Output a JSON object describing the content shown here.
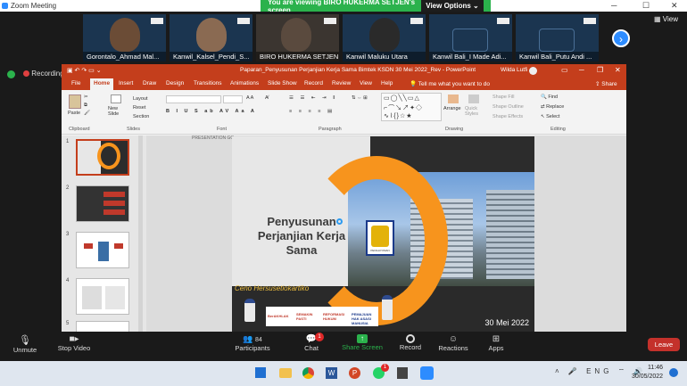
{
  "zoom": {
    "window_title": "Zoom Meeting",
    "banner_text": "You are viewing BIRO HUKERMA SETJEN's screen",
    "view_options_label": "View Options",
    "view_label": "View",
    "recording_label": "Recording",
    "participants": [
      {
        "name": "Gorontalo_Ahmad Mal..."
      },
      {
        "name": "Kanwil_Kalsel_Pendi_S..."
      },
      {
        "name": "BIRO HUKERMA SETJEN"
      },
      {
        "name": "Kanwil Maluku Utara"
      },
      {
        "name": "Kanwil Bali_I Made Adi..."
      },
      {
        "name": "Kanwil Bali_Putu Andi ..."
      }
    ],
    "toolbar": {
      "unmute": "Unmute",
      "stop_video": "Stop Video",
      "participants": "Participants",
      "participants_count": "84",
      "chat": "Chat",
      "chat_badge": "1",
      "share_screen": "Share Screen",
      "record": "Record",
      "reactions": "Reactions",
      "apps": "Apps",
      "leave": "Leave"
    }
  },
  "ppt": {
    "title": "Paparan_Penyusunan Perjanjian Kerja Sama Bimtek KSDN 30 Mei 2022_Rev  -  PowerPoint",
    "user": "Wilda Lutfi",
    "tabs": [
      "File",
      "Home",
      "Insert",
      "Draw",
      "Design",
      "Transitions",
      "Animations",
      "Slide Show",
      "Record",
      "Review",
      "View",
      "Help"
    ],
    "tell_me": "Tell me what you want to do",
    "share_label": "Share",
    "ribbon": {
      "paste": "Paste",
      "new_slide": "New Slide",
      "layout": "Layout",
      "reset": "Reset",
      "section": "Section",
      "arrange": "Arrange",
      "quick_styles": "Quick Styles",
      "shape_fill": "Shape Fill",
      "shape_outline": "Shape Outline",
      "shape_effects": "Shape Effects",
      "find": "Find",
      "replace": "Replace",
      "select": "Select",
      "groups": [
        "Clipboard",
        "Slides",
        "Font",
        "Paragraph",
        "Drawing",
        "Editing"
      ]
    },
    "thumbnail_numbers": [
      "1",
      "2",
      "3",
      "4",
      "5"
    ],
    "slide": {
      "brand": "PRESENTATION GO .com",
      "title": "Penyusunan Perjanjian Kerja Sama",
      "presenter": "Ceno Hersusetiokartiko",
      "date": "30 Mei 2022",
      "emblem_text": "PENGAYOMAN",
      "logos": [
        "BerAKHLAK",
        "SEMAKIN PASTI",
        "REFORMASI HUKUM",
        "PEMAJUAN HAK ASASI MANUSIA"
      ]
    }
  },
  "taskbar": {
    "time": "11:46",
    "date": "30/05/2022",
    "badge": "1"
  },
  "colors": {
    "ppt_accent": "#c43e1c",
    "zoom_green": "#2bb24c",
    "zoom_blue": "#2d8cff",
    "slide_orange": "#f7941d",
    "leave_red": "#c4312b"
  }
}
